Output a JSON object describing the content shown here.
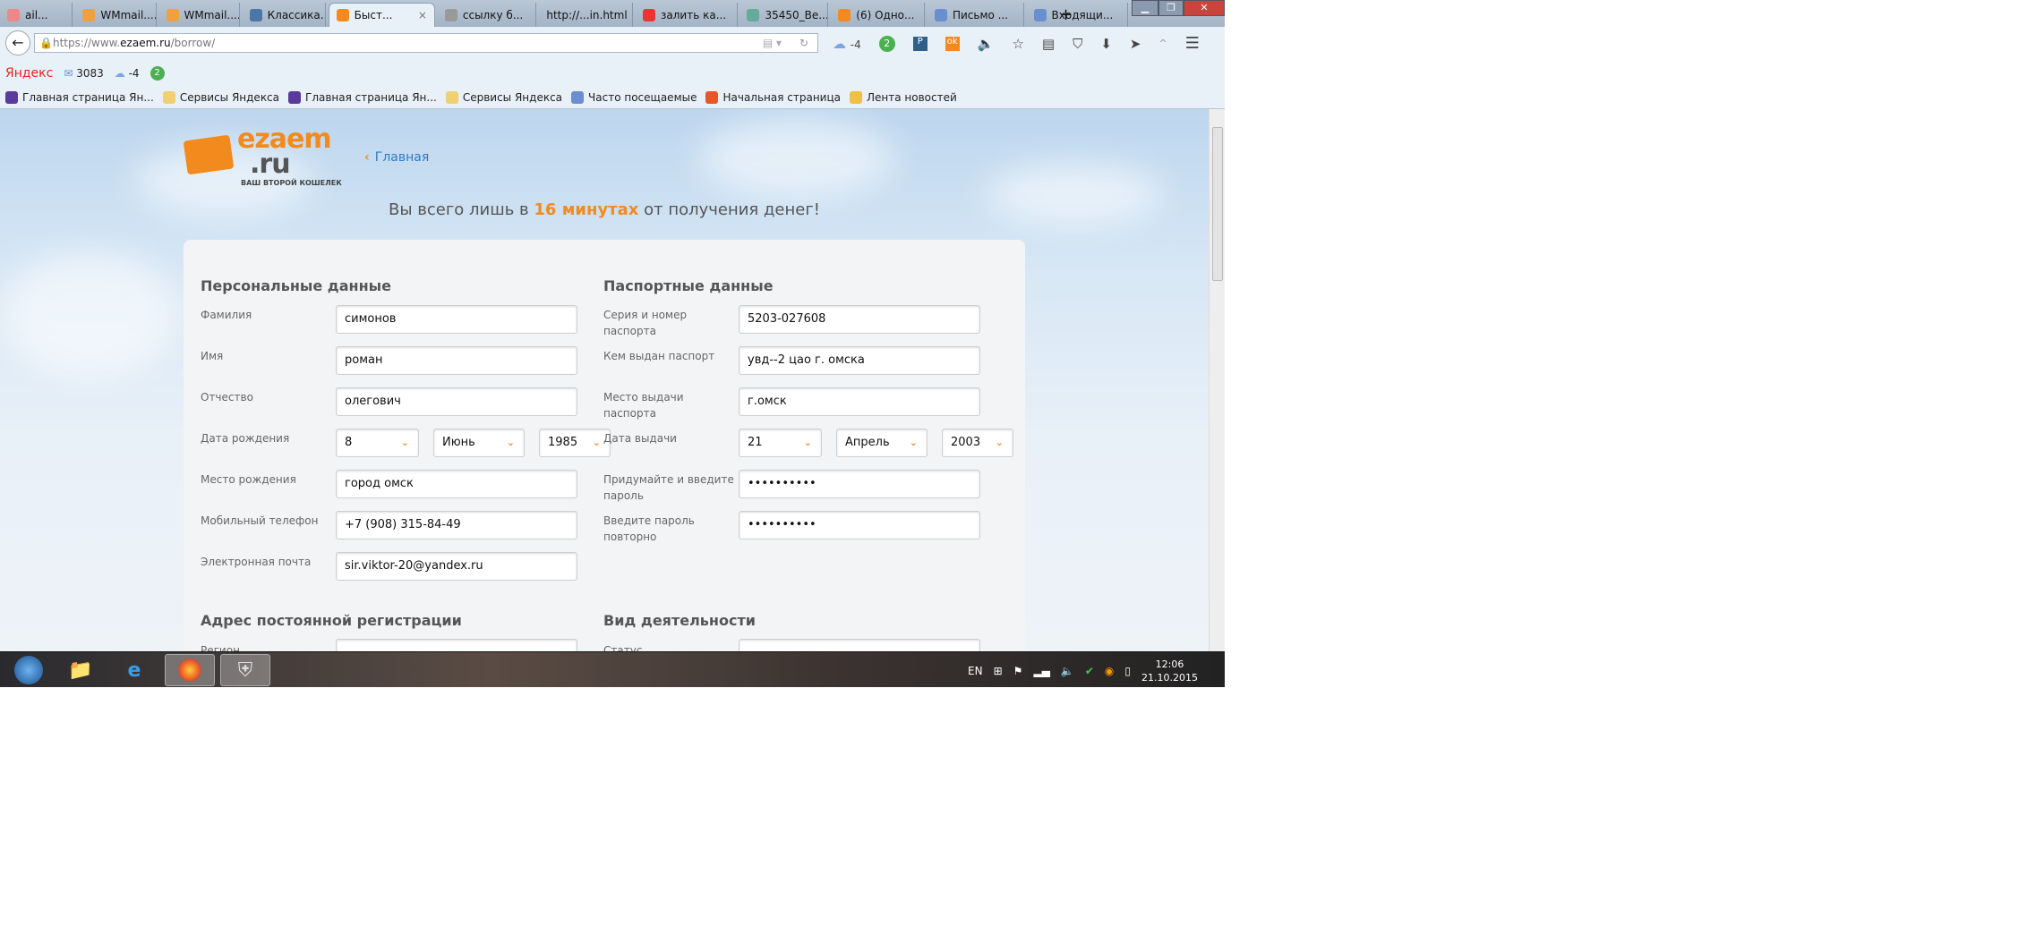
{
  "browser": {
    "tabs": [
      {
        "label": "ail...",
        "icon": "mail-icon",
        "color": "#e88"
      },
      {
        "label": "WMmail....",
        "icon": "wmmail-icon",
        "color": "#f0a040"
      },
      {
        "label": "WMmail....",
        "icon": "wmmail-icon",
        "color": "#f0a040"
      },
      {
        "label": "Классика...",
        "icon": "vk-icon",
        "color": "#4a76a8"
      },
      {
        "label": "Быст...",
        "icon": "wallet-icon",
        "color": "#f28a1e",
        "active": true
      },
      {
        "label": "ссылку б...",
        "icon": "page-icon",
        "color": "#999"
      },
      {
        "label": "http://...in.html",
        "icon": "",
        "color": ""
      },
      {
        "label": "залить ка...",
        "icon": "yandex-icon",
        "color": "#e33"
      },
      {
        "label": "35450_Ве...",
        "icon": "image-icon",
        "color": "#6a9"
      },
      {
        "label": "(6) Одно...",
        "icon": "ok-icon",
        "color": "#f28a1e"
      },
      {
        "label": "Письмо ...",
        "icon": "mail-icon",
        "color": "#6a8fd0"
      },
      {
        "label": "Входящи...",
        "icon": "mail-icon",
        "color": "#6a8fd0"
      }
    ],
    "tab_close": "×",
    "new_tab": "+",
    "url_prefix": "https://www.",
    "url_domain": "ezaem.ru",
    "url_path": "/borrow/",
    "weather": "-4",
    "badge": "2",
    "yandex": {
      "logo": "Яндекс",
      "mail_count": "3083",
      "weather": "-4",
      "badge": "2"
    },
    "bookmarks": [
      "Главная страница Ян...",
      "Сервисы Яндекса",
      "Главная страница Ян...",
      "Сервисы Яндекса",
      "Часто посещаемые",
      "Начальная страница",
      "Лента новостей"
    ]
  },
  "page": {
    "logo_main": "ezaem",
    "logo_ru": ".ru",
    "slogan": "ВАШ ВТОРОЙ КОШЕЛЕК",
    "home_link": "Главная",
    "tag_pre": "Вы всего лишь в ",
    "tag_bold": "16 минутах",
    "tag_post": " от получения денег!",
    "personal": {
      "title": "Персональные данные",
      "last_name": {
        "label": "Фамилия",
        "value": "симонов"
      },
      "first_name": {
        "label": "Имя",
        "value": "роман"
      },
      "patronymic": {
        "label": "Отчество",
        "value": "олегович"
      },
      "birth": {
        "label": "Дата рождения",
        "day": "8",
        "month": "Июнь",
        "year": "1985"
      },
      "birthplace": {
        "label": "Место рождения",
        "value": "город омск"
      },
      "phone": {
        "label": "Мобильный телефон",
        "value": "+7 (908) 315-84-49"
      },
      "email": {
        "label": "Электронная почта",
        "value": "sir.viktor-20@yandex.ru"
      }
    },
    "passport": {
      "title": "Паспортные данные",
      "number": {
        "label": "Серия и номер паспорта",
        "value": "5203-027608"
      },
      "issued_by": {
        "label": "Кем выдан паспорт",
        "value": "увд--2 цао г. омска"
      },
      "issue_place": {
        "label": "Место выдачи паспорта",
        "value": "г.омск"
      },
      "issue_date": {
        "label": "Дата выдачи",
        "day": "21",
        "month": "Апрель",
        "year": "2003"
      },
      "password": {
        "label": "Придумайте и введите пароль",
        "value": "••••••••••"
      },
      "password_repeat": {
        "label": "Введите пароль повторно",
        "value": "••••••••••"
      }
    },
    "address": {
      "title": "Адрес постоянной регистрации",
      "region_label": "Регион"
    },
    "activity": {
      "title": "Вид деятельности",
      "status_label": "Статус"
    }
  },
  "taskbar": {
    "lang": "EN",
    "time": "12:06",
    "date": "21.10.2015"
  }
}
